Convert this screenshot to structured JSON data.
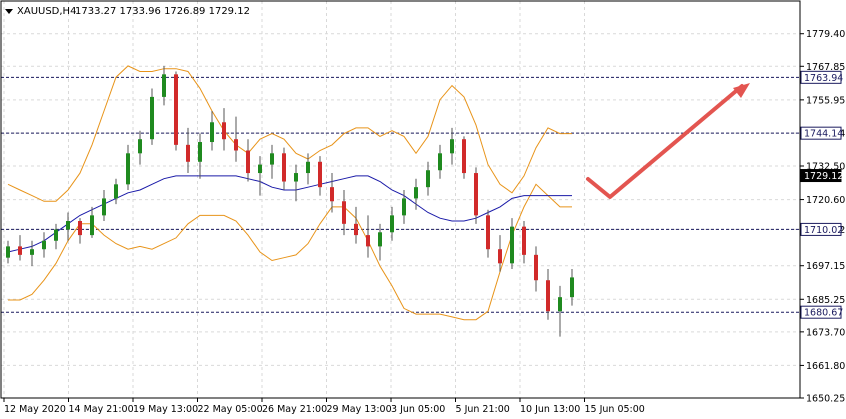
{
  "header": {
    "symbol": "XAUUSD,H4",
    "ohlc": "1733.27 1733.96 1726.89 1729.12"
  },
  "colors": {
    "bull": "#1f8a1f",
    "bear": "#d12a2a",
    "wick": "#555555",
    "bands": "#e8941a",
    "ma": "#1a1aa8",
    "level": "#1a1a5e",
    "arrow": "#e35550"
  },
  "chart_data": {
    "type": "candlestick",
    "title": "XAUUSD,H4",
    "ylim": [
      1650.25,
      1791.0
    ],
    "y_ticks": [
      "1779.40",
      "1767.85",
      "1755.95",
      "1744.14",
      "1732.50",
      "1720.60",
      "1710.02",
      "1697.15",
      "1685.25",
      "1673.70",
      "1661.80",
      "1650.25"
    ],
    "x_ticks": [
      "12 May 2020",
      "14 May 21:00",
      "19 May 13:00",
      "22 May 05:00",
      "26 May 21:00",
      "29 May 13:00",
      "3 Jun 05:00",
      "5 Jun 21:00",
      "10 Jun 13:00",
      "15 Jun 05:00"
    ],
    "levels": [
      {
        "label": "1763.94",
        "value": 1763.94
      },
      {
        "label": "1744.14",
        "value": 1744.14
      },
      {
        "label": "1710.02",
        "value": 1710.02
      },
      {
        "label": "1680.67",
        "value": 1680.67
      }
    ],
    "current_price": {
      "label": "1729.12",
      "value": 1729.12
    },
    "series": [
      {
        "name": "Bollinger upper",
        "values": [
          1726,
          1724,
          1722,
          1720,
          1720,
          1724,
          1730,
          1740,
          1752,
          1764,
          1768,
          1766,
          1766,
          1767,
          1767,
          1766,
          1760,
          1752,
          1745,
          1740,
          1737,
          1742,
          1744,
          1742,
          1737,
          1735,
          1738,
          1740,
          1744,
          1746,
          1746,
          1743,
          1745,
          1743,
          1737,
          1743,
          1756,
          1761,
          1757,
          1747,
          1733,
          1726,
          1723,
          1729,
          1739,
          1746,
          1744,
          1744
        ]
      },
      {
        "name": "Bollinger lower",
        "values": [
          1685,
          1685,
          1687,
          1692,
          1698,
          1706,
          1712,
          1712,
          1708,
          1705,
          1703,
          1704,
          1703,
          1705,
          1707,
          1712,
          1715,
          1715,
          1715,
          1713,
          1708,
          1702,
          1699,
          1700,
          1701,
          1705,
          1712,
          1718,
          1718,
          1714,
          1706,
          1697,
          1690,
          1682,
          1680,
          1680,
          1680,
          1679,
          1678,
          1678,
          1681,
          1695,
          1708,
          1718,
          1726,
          1722,
          1718,
          1718
        ]
      },
      {
        "name": "Moving average",
        "values": [
          1702,
          1703,
          1704,
          1706,
          1709,
          1712,
          1715,
          1717,
          1719,
          1721,
          1723,
          1724,
          1726,
          1728,
          1729,
          1729,
          1729,
          1729,
          1729,
          1729,
          1728,
          1727,
          1725,
          1724,
          1724,
          1725,
          1726,
          1727,
          1728,
          1729,
          1729,
          1727,
          1724,
          1722,
          1719,
          1716,
          1714,
          1713,
          1713,
          1714,
          1716,
          1718,
          1721,
          1722,
          1722,
          1722,
          1722,
          1722
        ]
      }
    ],
    "candles": [
      [
        1700,
        1706,
        1698,
        1704
      ],
      [
        1704,
        1708,
        1699,
        1701
      ],
      [
        1701,
        1706,
        1697,
        1703
      ],
      [
        1703,
        1709,
        1700,
        1706
      ],
      [
        1706,
        1712,
        1703,
        1710
      ],
      [
        1710,
        1716,
        1706,
        1713
      ],
      [
        1713,
        1714,
        1705,
        1708
      ],
      [
        1708,
        1718,
        1707,
        1715
      ],
      [
        1715,
        1724,
        1713,
        1721
      ],
      [
        1721,
        1728,
        1719,
        1726
      ],
      [
        1726,
        1740,
        1724,
        1737
      ],
      [
        1737,
        1745,
        1733,
        1742
      ],
      [
        1742,
        1760,
        1740,
        1757
      ],
      [
        1757,
        1768,
        1754,
        1765
      ],
      [
        1765,
        1766,
        1738,
        1740
      ],
      [
        1740,
        1746,
        1730,
        1734
      ],
      [
        1734,
        1744,
        1728,
        1741
      ],
      [
        1741,
        1752,
        1738,
        1748
      ],
      [
        1748,
        1753,
        1738,
        1742
      ],
      [
        1742,
        1750,
        1734,
        1738
      ],
      [
        1738,
        1742,
        1727,
        1730
      ],
      [
        1730,
        1736,
        1722,
        1733
      ],
      [
        1733,
        1740,
        1728,
        1737
      ],
      [
        1737,
        1739,
        1724,
        1727
      ],
      [
        1727,
        1733,
        1720,
        1730
      ],
      [
        1730,
        1737,
        1726,
        1734
      ],
      [
        1734,
        1736,
        1722,
        1725
      ],
      [
        1725,
        1730,
        1716,
        1720
      ],
      [
        1720,
        1724,
        1708,
        1712
      ],
      [
        1712,
        1718,
        1705,
        1708
      ],
      [
        1708,
        1715,
        1700,
        1704
      ],
      [
        1704,
        1712,
        1699,
        1709
      ],
      [
        1709,
        1718,
        1706,
        1715
      ],
      [
        1715,
        1724,
        1712,
        1721
      ],
      [
        1721,
        1728,
        1717,
        1725
      ],
      [
        1725,
        1734,
        1722,
        1731
      ],
      [
        1731,
        1740,
        1728,
        1737
      ],
      [
        1737,
        1746,
        1733,
        1742
      ],
      [
        1742,
        1743,
        1728,
        1730
      ],
      [
        1730,
        1732,
        1712,
        1715
      ],
      [
        1715,
        1717,
        1700,
        1703
      ],
      [
        1703,
        1708,
        1695,
        1698
      ],
      [
        1698,
        1714,
        1696,
        1711
      ],
      [
        1711,
        1713,
        1698,
        1701
      ],
      [
        1701,
        1704,
        1688,
        1692
      ],
      [
        1692,
        1696,
        1678,
        1681
      ],
      [
        1681,
        1690,
        1672,
        1686
      ],
      [
        1686,
        1696,
        1683,
        1693
      ]
    ]
  }
}
